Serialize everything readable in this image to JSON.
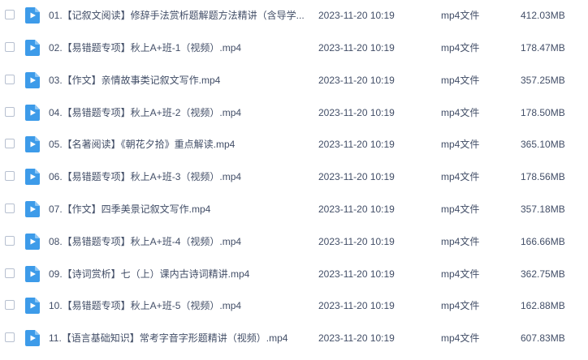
{
  "files": [
    {
      "name": "01.【记叙文阅读】修辞手法赏析题解题方法精讲（含导学...",
      "time": "2023-11-20 10:19",
      "type": "mp4文件",
      "size": "412.03MB"
    },
    {
      "name": "02.【易错题专项】秋上A+班-1（视频）.mp4",
      "time": "2023-11-20 10:19",
      "type": "mp4文件",
      "size": "178.47MB"
    },
    {
      "name": "03.【作文】亲情故事类记叙文写作.mp4",
      "time": "2023-11-20 10:19",
      "type": "mp4文件",
      "size": "357.25MB"
    },
    {
      "name": "04.【易错题专项】秋上A+班-2（视频）.mp4",
      "time": "2023-11-20 10:19",
      "type": "mp4文件",
      "size": "178.50MB"
    },
    {
      "name": "05.【名著阅读】《朝花夕拾》重点解读.mp4",
      "time": "2023-11-20 10:19",
      "type": "mp4文件",
      "size": "365.10MB"
    },
    {
      "name": "06.【易错题专项】秋上A+班-3（视频）.mp4",
      "time": "2023-11-20 10:19",
      "type": "mp4文件",
      "size": "178.56MB"
    },
    {
      "name": "07.【作文】四季美景记叙文写作.mp4",
      "time": "2023-11-20 10:19",
      "type": "mp4文件",
      "size": "357.18MB"
    },
    {
      "name": "08.【易错题专项】秋上A+班-4（视频）.mp4",
      "time": "2023-11-20 10:19",
      "type": "mp4文件",
      "size": "166.66MB"
    },
    {
      "name": "09.【诗词赏析】七（上）课内古诗词精讲.mp4",
      "time": "2023-11-20 10:19",
      "type": "mp4文件",
      "size": "362.75MB"
    },
    {
      "name": "10.【易错题专项】秋上A+班-5（视频）.mp4",
      "time": "2023-11-20 10:19",
      "type": "mp4文件",
      "size": "162.88MB"
    },
    {
      "name": "11.【语言基础知识】常考字音字形题精讲（视频）.mp4",
      "time": "2023-11-20 10:19",
      "type": "mp4文件",
      "size": "607.83MB"
    }
  ],
  "colors": {
    "icon_blue": "#3d9be9",
    "text": "#424e67",
    "checkbox_border": "#b7c0d0"
  }
}
